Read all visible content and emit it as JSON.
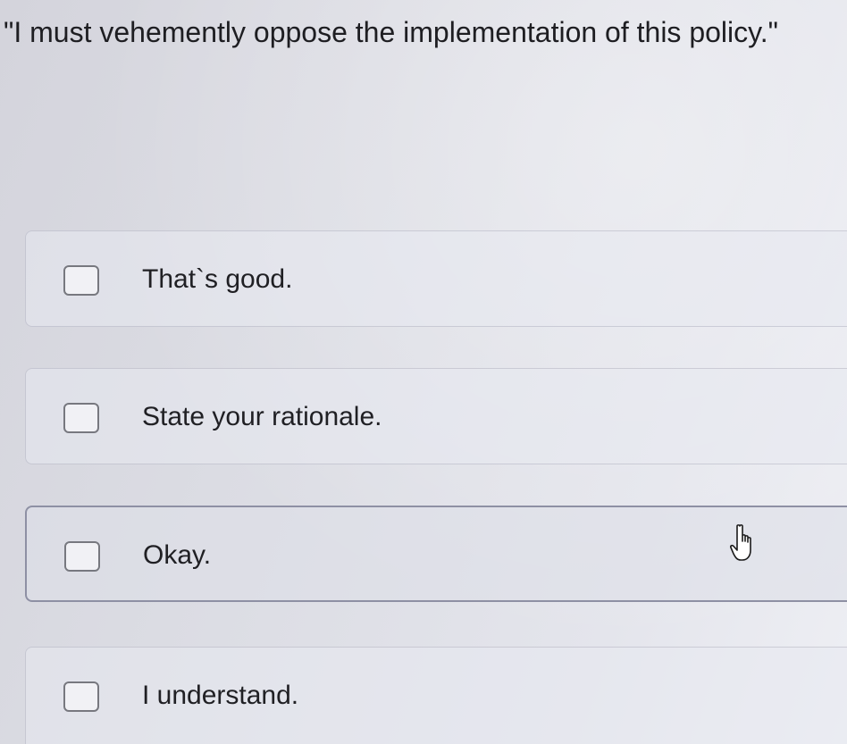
{
  "question": {
    "text": "\"I must vehemently oppose the implementation of this policy.\""
  },
  "options": [
    {
      "label": "That`s good.",
      "checked": false
    },
    {
      "label": "State your rationale.",
      "checked": false
    },
    {
      "label": "Okay.",
      "checked": false
    },
    {
      "label": "I understand.",
      "checked": false
    }
  ],
  "cursor": {
    "icon": "hand-pointer-icon",
    "hovered_option": "Okay."
  },
  "colors": {
    "background": "#dcdde4",
    "text": "#1e1e22",
    "checkbox_border": "#77787f",
    "hover_border": "#8e90a4"
  }
}
